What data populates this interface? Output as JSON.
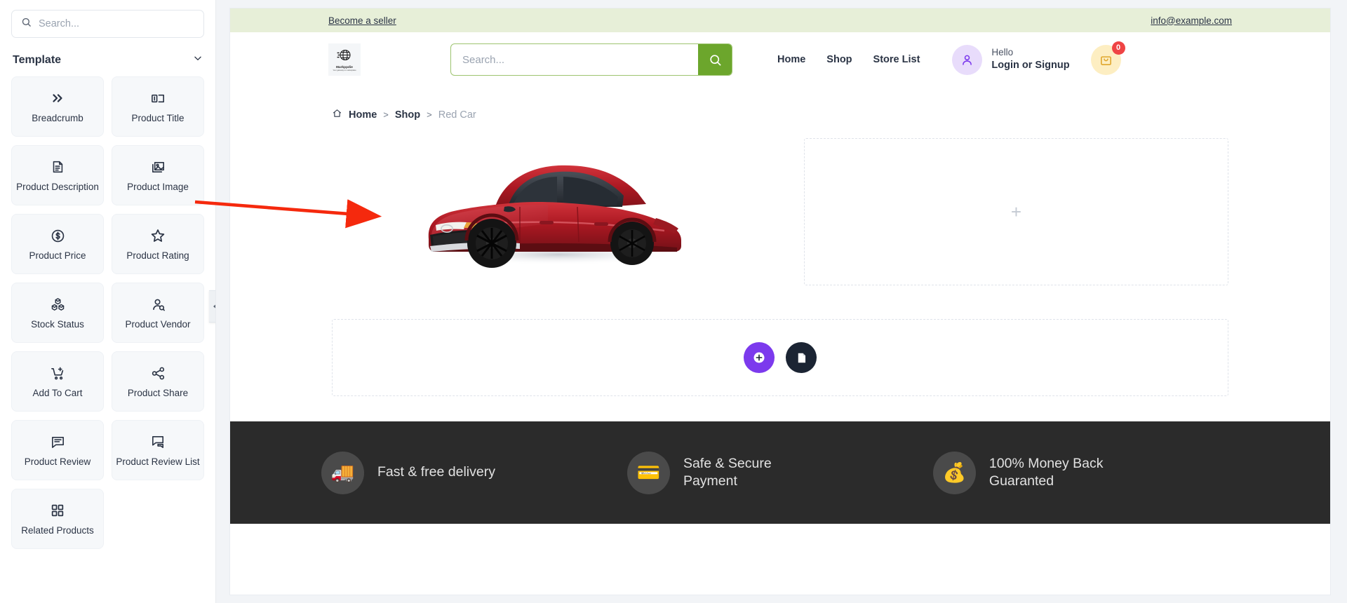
{
  "sidebar": {
    "search": {
      "placeholder": "Search...",
      "icon": "search-icon"
    },
    "section": {
      "title": "Template",
      "chevron": "chevron-down-icon"
    },
    "widgets": [
      {
        "label": "Breadcrumb",
        "icon": "double-chevron-right-icon"
      },
      {
        "label": "Product Title",
        "icon": "title-block-icon"
      },
      {
        "label": "Product Description",
        "icon": "document-text-icon"
      },
      {
        "label": "Product Image",
        "icon": "image-icon"
      },
      {
        "label": "Product Price",
        "icon": "dollar-circle-icon"
      },
      {
        "label": "Product Rating",
        "icon": "star-icon"
      },
      {
        "label": "Stock Status",
        "icon": "boxes-icon"
      },
      {
        "label": "Product Vendor",
        "icon": "user-tag-icon"
      },
      {
        "label": "Add To Cart",
        "icon": "cart-plus-icon"
      },
      {
        "label": "Product Share",
        "icon": "share-icon"
      },
      {
        "label": "Product Review",
        "icon": "comment-lines-icon"
      },
      {
        "label": "Product Review List",
        "icon": "comments-icon"
      },
      {
        "label": "Related Products",
        "icon": "grid-icon"
      }
    ],
    "collapse": {
      "icon": "chevron-left-icon"
    }
  },
  "preview": {
    "topbar": {
      "seller_link": "Become a seller",
      "email": "info@example.com",
      "background": "#e7efd8"
    },
    "header": {
      "logo": {
        "name": "Markppdie",
        "tagline": "Your gateway to marketplace"
      },
      "search": {
        "placeholder": "Search...",
        "button_icon": "search-icon",
        "accent": "#6ca62c"
      },
      "nav": [
        "Home",
        "Shop",
        "Store List"
      ],
      "account": {
        "greeting": "Hello",
        "action": "Login or Signup",
        "avatar_icon": "user-icon"
      },
      "cart": {
        "icon": "shopping-bag-icon",
        "count": "0",
        "badge_color": "#ef4444"
      }
    },
    "breadcrumb": {
      "home_icon": "home-icon",
      "items": [
        "Home",
        "Shop"
      ],
      "current": "Red Car",
      "separator": ">"
    },
    "product_image": {
      "alt": "Red Car",
      "color": "#b01a22"
    },
    "dropzones": {
      "right_column": {
        "plus": "+"
      },
      "bottom_row": {
        "add_button": {
          "icon": "plus-circle-icon",
          "color": "#7c3aed"
        },
        "template_button": {
          "icon": "document-icon",
          "color": "#1b2433"
        }
      }
    },
    "footer": {
      "background": "#2b2b2b",
      "features": [
        {
          "icon": "delivery-truck-icon",
          "text": "Fast & free delivery"
        },
        {
          "icon": "credit-card-lock-icon",
          "text": "Safe & Secure Payment"
        },
        {
          "icon": "money-coin-icon",
          "text": "100% Money Back Guaranted"
        }
      ]
    }
  },
  "annotation": {
    "type": "arrow",
    "color": "#f5290d",
    "from": "Product Image",
    "to": "product image area"
  }
}
